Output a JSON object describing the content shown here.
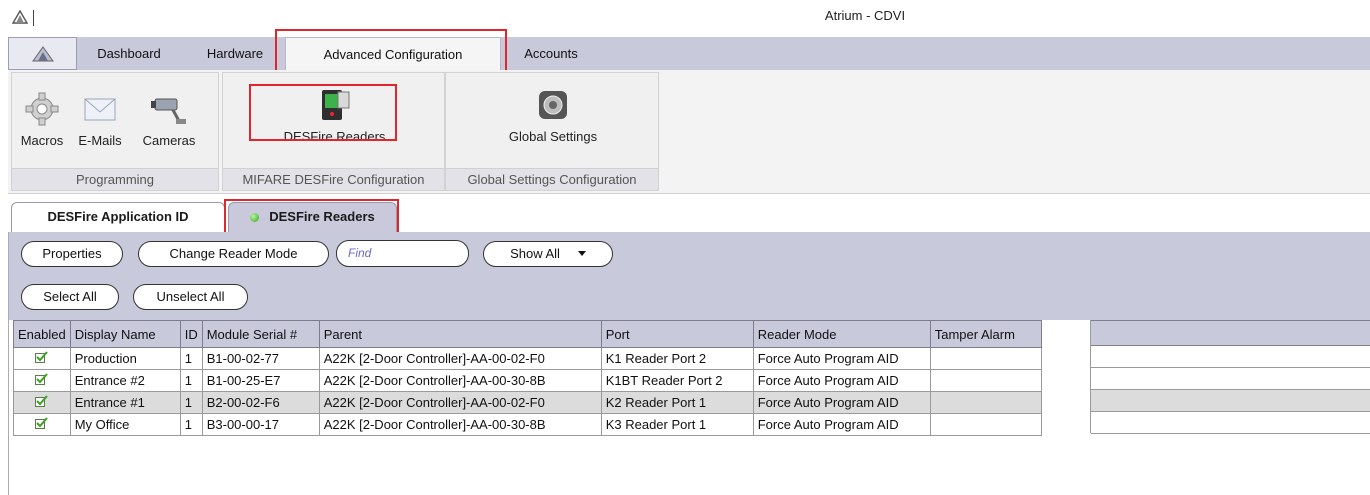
{
  "window": {
    "title": "Atrium - CDVI"
  },
  "ribbon": {
    "tabs": [
      {
        "label": "Dashboard"
      },
      {
        "label": "Hardware"
      },
      {
        "label": "Advanced Configuration"
      },
      {
        "label": "Accounts"
      }
    ],
    "active_tab": "Advanced Configuration",
    "groups": {
      "programming": {
        "label": "Programming",
        "buttons": [
          {
            "label": "Macros",
            "icon": "gear-icon"
          },
          {
            "label": "E-Mails",
            "icon": "envelope-icon"
          },
          {
            "label": "Cameras",
            "icon": "camera-icon"
          }
        ]
      },
      "mifare": {
        "label": "MIFARE DESFire Configuration",
        "buttons": [
          {
            "label": "DESFire Readers",
            "icon": "card-reader-icon"
          }
        ]
      },
      "global": {
        "label": "Global Settings Configuration",
        "buttons": [
          {
            "label": "Global Settings",
            "icon": "settings-icon"
          }
        ]
      }
    }
  },
  "doc_tabs": [
    {
      "label": "DESFire Application ID"
    },
    {
      "label": "DESFire Readers",
      "status": "green"
    }
  ],
  "toolbar": {
    "properties": "Properties",
    "change_reader_mode": "Change Reader Mode",
    "find_placeholder": "Find",
    "show_filter": "Show All",
    "select_all": "Select All",
    "unselect_all": "Unselect All"
  },
  "grid": {
    "columns": [
      "Enabled",
      "Display Name",
      "ID",
      "Module Serial #",
      "Parent",
      "Port",
      "Reader Mode",
      "Tamper Alarm"
    ],
    "rows": [
      {
        "enabled": true,
        "display_name": "Production",
        "id": "1",
        "serial": "B1-00-02-77",
        "parent": "A22K [2-Door Controller]-AA-00-02-F0",
        "port": "K1 Reader Port 2",
        "mode": "Force Auto Program AID",
        "tamper": ""
      },
      {
        "enabled": true,
        "display_name": "Entrance #2",
        "id": "1",
        "serial": "B1-00-25-E7",
        "parent": "A22K [2-Door Controller]-AA-00-30-8B",
        "port": "K1BT Reader Port 2",
        "mode": "Force Auto Program AID",
        "tamper": ""
      },
      {
        "enabled": true,
        "display_name": "Entrance #1",
        "id": "1",
        "serial": "B2-00-02-F6",
        "parent": "A22K [2-Door Controller]-AA-00-02-F0",
        "port": "K2 Reader Port 1",
        "mode": "Force Auto Program AID",
        "tamper": ""
      },
      {
        "enabled": true,
        "display_name": "My Office",
        "id": "1",
        "serial": "B3-00-00-17",
        "parent": "A22K [2-Door Controller]-AA-00-30-8B",
        "port": "K3 Reader Port 1",
        "mode": "Force Auto Program AID",
        "tamper": ""
      }
    ]
  },
  "colors": {
    "highlight": "#e0262d",
    "ribbon": "#c9c9dc",
    "check": "#3aa31e"
  }
}
